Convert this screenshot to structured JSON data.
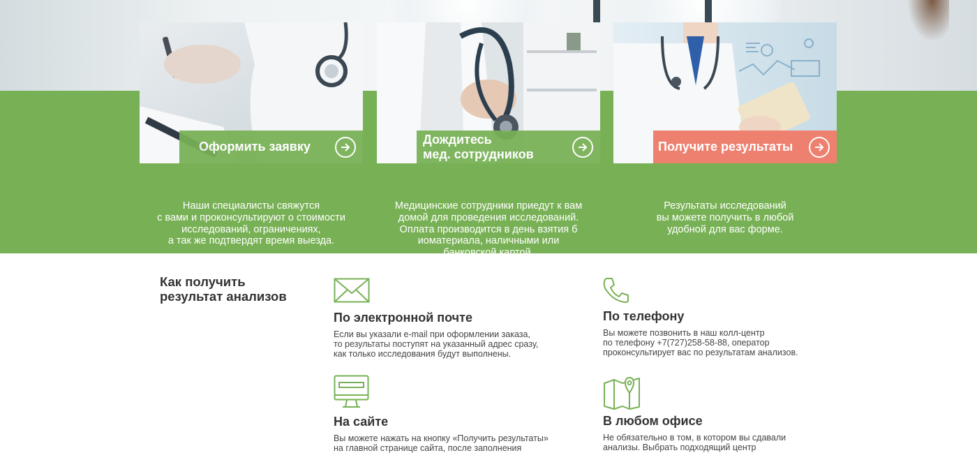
{
  "steps": [
    {
      "title": "Оформить заявку",
      "description_lines": [
        "Наши специалисты свяжутся",
        "с вами и проконсультируют о стоимости",
        "исследований, ограничениях,",
        "а так же подтвердят время выезда."
      ],
      "label_color": "#78b155",
      "icon": "arrow-right-circle-icon"
    },
    {
      "title_lines": [
        "Дождитесь",
        "мед. сотрудников"
      ],
      "description_lines": [
        "Медицинские сотрудники приедут к вам",
        "домой для проведения исследований.",
        "Оплата производится в день взятия б",
        "иоматериала, наличными или",
        "банковской картой."
      ],
      "label_color": "#78b155",
      "icon": "arrow-right-circle-icon"
    },
    {
      "title": "Получите результаты",
      "description_lines": [
        "Результаты исследований",
        "вы можете получить в любой",
        "удобной для вас форме."
      ],
      "label_color": "#ee8070",
      "icon": "arrow-right-circle-icon"
    }
  ],
  "results": {
    "title_lines": [
      "Как получить",
      "результат анализов"
    ],
    "methods": [
      {
        "title": "По электронной почте",
        "icon": "envelope-icon",
        "text_lines": [
          "Если вы указали e-mail при оформлении заказа,",
          "то результаты поступят на указанный адрес сразу,",
          "как только исследования будут выполнены."
        ]
      },
      {
        "title": "По телефону",
        "icon": "phone-icon",
        "text_lines": [
          "Вы можете позвонить в наш колл-центр",
          "по телефону +7(727)258-58-88, оператор",
          "проконсультирует вас по результатам анализов."
        ]
      },
      {
        "title": "На сайте",
        "icon": "monitor-icon",
        "text_lines": [
          "Вы можете нажать на кнопку «Получить результаты»",
          "на главной странице сайта, после заполнения"
        ]
      },
      {
        "title": "В любом офисе",
        "icon": "map-pin-icon",
        "text_lines": [
          "Не обязательно в том, в котором вы сдавали",
          "анализы. Выбрать подходящий центр"
        ]
      }
    ]
  },
  "colors": {
    "brand_green": "#78b155",
    "accent_red": "#ee8070",
    "heading_text": "#333333",
    "body_text": "#444444"
  }
}
